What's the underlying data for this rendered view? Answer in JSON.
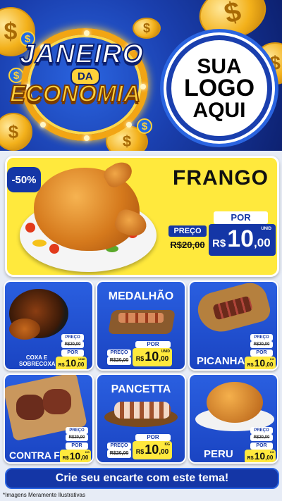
{
  "header": {
    "title_line1": "JANEIRO",
    "title_da": "DA",
    "title_line2": "ECONOMIA",
    "logo_placeholder": [
      "SUA",
      "LOGO",
      "AQUI"
    ]
  },
  "featured": {
    "discount_badge": "-50%",
    "name": "FRANGO",
    "por_label": "POR",
    "preco_label": "PREÇO",
    "old_price": "R$20,00",
    "currency": "R$",
    "price_int": "10",
    "price_cents": ",00",
    "unit": "UNID"
  },
  "products": [
    {
      "name": "COXA E SOBRECOXA",
      "preco_label": "PREÇO",
      "old_price": "R$20,00",
      "por_label": "POR",
      "currency": "R$",
      "price_int": "10",
      "price_cents": ",00",
      "unit": "UNID"
    },
    {
      "name": "MEDALHÃO",
      "preco_label": "PREÇO",
      "old_price": "R$20,00",
      "por_label": "POR",
      "currency": "R$",
      "price_int": "10",
      "price_cents": ",00",
      "unit": "UNID"
    },
    {
      "name": "PICANHA",
      "preco_label": "PREÇO",
      "old_price": "R$20,00",
      "por_label": "POR",
      "currency": "R$",
      "price_int": "10",
      "price_cents": ",00",
      "unit": "KG"
    },
    {
      "name": "CONTRA FILE",
      "preco_label": "PREÇO",
      "old_price": "R$20,00",
      "por_label": "POR",
      "currency": "R$",
      "price_int": "10",
      "price_cents": ",00",
      "unit": "KG"
    },
    {
      "name": "PANCETTA",
      "preco_label": "PREÇO",
      "old_price": "R$20,00",
      "por_label": "POR",
      "currency": "R$",
      "price_int": "10",
      "price_cents": ",00",
      "unit": "KG"
    },
    {
      "name": "PERU",
      "preco_label": "PREÇO",
      "old_price": "R$20,00",
      "por_label": "POR",
      "currency": "R$",
      "price_int": "10",
      "price_cents": ",00",
      "unit": "KG"
    }
  ],
  "cta": "Crie seu encarte com este tema!",
  "footnote": "*Imagens Meramente Ilustrativas",
  "colors": {
    "primary_blue": "#1436a6",
    "accent_yellow": "#ffe93d",
    "gold": "#f3b11b"
  }
}
